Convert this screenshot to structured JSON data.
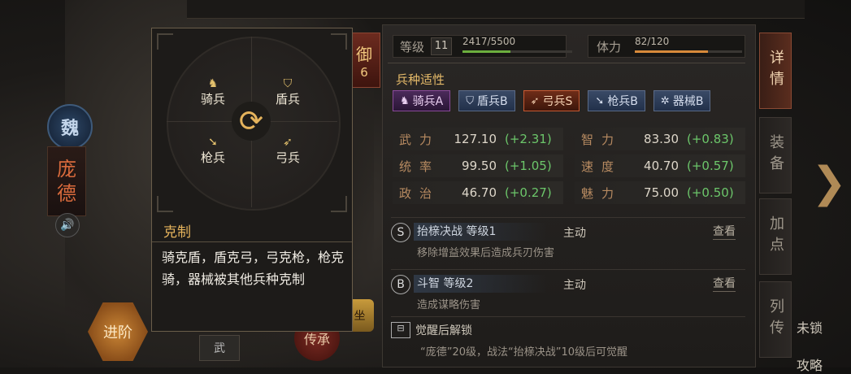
{
  "left": {
    "emblem": "魏",
    "name": [
      "庞",
      "德"
    ],
    "advance_button": "进阶",
    "bottom_tab": "武",
    "inherit_button": "传承",
    "gold_side": "坐",
    "defense_badge": {
      "char": "御",
      "value": "6"
    }
  },
  "stats_header": {
    "level_label": "等级",
    "level_value": "11",
    "exp_text": "2417/5500",
    "exp_progress": 0.44,
    "stamina_label": "体力",
    "stamina_text": "82/120",
    "stamina_progress": 0.68
  },
  "affinity": {
    "title": "兵种适性",
    "items": [
      {
        "label": "骑兵A",
        "icon": "horse-icon",
        "symbol": "♞",
        "grade": "A"
      },
      {
        "label": "盾兵B",
        "icon": "shield-icon",
        "symbol": "⛉",
        "grade": "B"
      },
      {
        "label": "弓兵S",
        "icon": "bow-icon",
        "symbol": "➶",
        "grade": "S"
      },
      {
        "label": "枪兵B",
        "icon": "spear-icon",
        "symbol": "➘",
        "grade": "B"
      },
      {
        "label": "器械B",
        "icon": "gear-icon",
        "symbol": "✲",
        "grade": "B"
      }
    ]
  },
  "attributes": [
    {
      "label": "武力",
      "value": "127.10",
      "bonus": "(+2.31)"
    },
    {
      "label": "智力",
      "value": "83.30",
      "bonus": "(+0.83)"
    },
    {
      "label": "统率",
      "value": "99.50",
      "bonus": "(+1.05)"
    },
    {
      "label": "速度",
      "value": "40.70",
      "bonus": "(+0.57)"
    },
    {
      "label": "政治",
      "value": "46.70",
      "bonus": "(+0.27)"
    },
    {
      "label": "魅力",
      "value": "75.00",
      "bonus": "(+0.50)"
    }
  ],
  "skills": [
    {
      "grade": "S",
      "name": "抬榇决战 等级1",
      "kind": "主动",
      "view": "查看",
      "desc": "移除增益效果后造成兵刃伤害"
    },
    {
      "grade": "B",
      "name": "斗智 等级2",
      "kind": "主动",
      "view": "查看",
      "desc": "造成谋略伤害"
    }
  ],
  "awaken": {
    "title": "觉醒后解锁",
    "desc": "“庞德”20级，战法“抬榇决战”10级后可觉醒"
  },
  "right_tabs": [
    "详情",
    "装备",
    "加点",
    "列传"
  ],
  "right_labels": {
    "lock": "未锁",
    "strategy": "攻略"
  },
  "popup": {
    "units": {
      "cavalry": "骑兵",
      "shield": "盾兵",
      "spear": "枪兵",
      "archer": "弓兵"
    },
    "title": "克制",
    "text": "骑克盾，盾克弓，弓克枪，枪克骑，器械被其他兵种克制"
  },
  "colors": {
    "accent_gold": "#e5b35c",
    "bonus_green": "#6cc66a",
    "exp_green": "#6cae3e",
    "stamina_orange": "#d88a3a",
    "active_tab": "#5a2d1e"
  }
}
